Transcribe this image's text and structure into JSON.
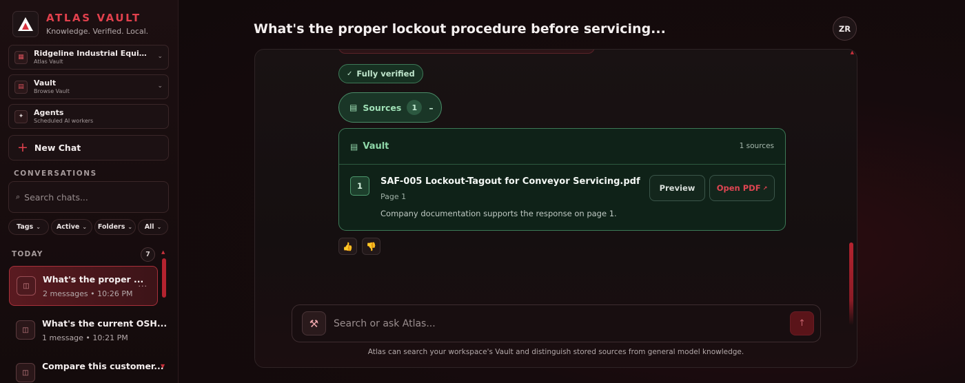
{
  "brand": {
    "name": "ATLAS VAULT",
    "tagline": "Knowledge. Verified. Local."
  },
  "nav": [
    {
      "title": "Ridgeline Industrial Equipme...",
      "subtitle": "Atlas Vault",
      "icon": "workspace-icon"
    },
    {
      "title": "Vault",
      "subtitle": "Browse Vault",
      "icon": "vault-icon"
    },
    {
      "title": "Agents",
      "subtitle": "Scheduled AI workers",
      "icon": "sparkle-icon"
    }
  ],
  "new_chat_label": "New Chat",
  "conversations_label": "CONVERSATIONS",
  "search_placeholder": "Search chats...",
  "filters": [
    {
      "label": "Tags"
    },
    {
      "label": "Active"
    },
    {
      "label": "Folders"
    },
    {
      "label": "All"
    }
  ],
  "today": {
    "label": "TODAY",
    "count": "7"
  },
  "chats": [
    {
      "title": "What's the proper ...",
      "messages": "2 messages",
      "time": "10:26 PM",
      "active": true
    },
    {
      "title": "What's the current OSH...",
      "messages": "1 message",
      "time": "10:21 PM",
      "active": false
    },
    {
      "title": "Compare this customer...",
      "messages": "",
      "time": "",
      "active": false
    }
  ],
  "main": {
    "title": "What's the proper lockout procedure before servicing...",
    "avatar_initials": "ZR",
    "verified_label": "Fully verified",
    "sources_label": "Sources",
    "sources_count": "1",
    "vault": {
      "title": "Vault",
      "count_label": "1 sources",
      "source": {
        "number": "1",
        "name": "SAF-005 Lockout-Tagout for Conveyor Servicing.pdf",
        "page": "Page 1",
        "description": "Company documentation supports the response on page 1."
      },
      "preview_label": "Preview",
      "open_label": "Open PDF"
    },
    "composer_placeholder": "Search or ask Atlas...",
    "disclaimer": "Atlas can search your workspace's Vault and distinguish stored sources from general model knowledge."
  },
  "colors": {
    "accent": "#e2414d",
    "verified_green": "#8fd8a9",
    "background": "#120b0c"
  }
}
